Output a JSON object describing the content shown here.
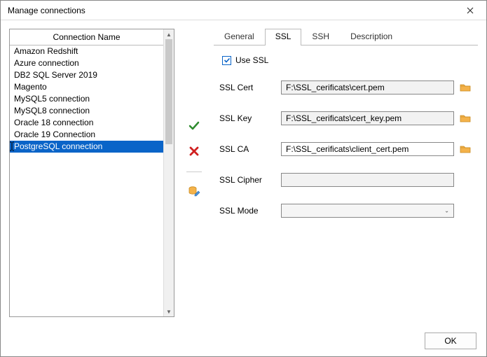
{
  "dialog": {
    "title": "Manage connections"
  },
  "list": {
    "header": "Connection Name",
    "items": [
      "Amazon Redshift",
      "Azure connection",
      "DB2 SQL Server 2019",
      "Magento",
      "MySQL5 connection",
      "MySQL8 connection",
      "Oracle 18 connection",
      "Oracle 19 Connection",
      "PostgreSQL connection"
    ],
    "selected_index": 8
  },
  "tabs": {
    "items": [
      "General",
      "SSL",
      "SSH",
      "Description"
    ],
    "active_index": 1
  },
  "ssl": {
    "use_ssl_label": "Use SSL",
    "use_ssl_checked": true,
    "cert_label": "SSL Cert",
    "cert_value": "F:\\SSL_cerificats\\cert.pem",
    "key_label": "SSL Key",
    "key_value": "F:\\SSL_cerificats\\cert_key.pem",
    "ca_label": "SSL CA",
    "ca_value": "F:\\SSL_cerificats\\client_cert.pem",
    "cipher_label": "SSL Cipher",
    "cipher_value": "",
    "mode_label": "SSL Mode",
    "mode_value": ""
  },
  "buttons": {
    "ok": "OK"
  }
}
